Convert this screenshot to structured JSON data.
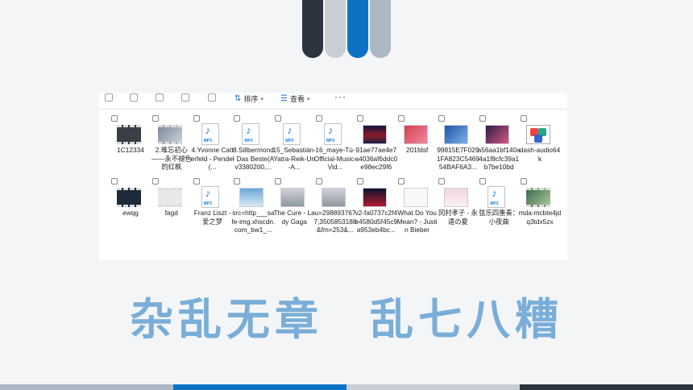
{
  "toolbar": {
    "sort_label": "排序",
    "view_label": "查看",
    "more_label": "···"
  },
  "files_row1": [
    {
      "name": "1C12334",
      "icon": "video-icon",
      "style": "ic-video"
    },
    {
      "name": "2.难忘初心——永不褪色的红枫",
      "icon": "video-icon",
      "style": "ic-video photo"
    },
    {
      "name": "4.Yvonne Catterfeld - Pendel(...",
      "icon": "mp3-icon",
      "style": "mp3"
    },
    {
      "name": "8.Sillbermond - Das Beste(Av3380200,...",
      "icon": "mp3-icon",
      "style": "mp3"
    },
    {
      "name": "15_Sebastián-Yatra-Reik-Un-A...",
      "icon": "mp3-icon",
      "style": "mp3"
    },
    {
      "name": "16_maye-Tú-Official-Music-Vid...",
      "icon": "mp3-icon",
      "style": "mp3"
    },
    {
      "name": "91ae77ae4e7a4036af6ddc0e98ec29f6",
      "icon": "image-icon",
      "style": "ic-img stage"
    },
    {
      "name": "201fdsf",
      "icon": "image-icon",
      "style": "ic-img red"
    },
    {
      "name": "99815E7F0291FA823C546954BAF6A3...",
      "icon": "image-icon",
      "style": "ic-img blue"
    },
    {
      "name": "a56aa1bf140a4a1f8cfc39a1b7be10bd",
      "icon": "image-icon",
      "style": "ic-img concert"
    },
    {
      "name": "dash-audio64k",
      "icon": "media-file-icon",
      "style": "dash"
    }
  ],
  "files_row2": [
    {
      "name": "ewqg",
      "icon": "video-icon",
      "style": "ic-video dark"
    },
    {
      "name": "fagd",
      "icon": "video-icon",
      "style": "ic-video frame"
    },
    {
      "name": "Franz Liszt - 爱之梦",
      "icon": "mp3-icon",
      "style": "mp3"
    },
    {
      "name": "src=http___safe-img.xhscdn.com_bw1_...",
      "icon": "image-icon",
      "style": "ic-img sky"
    },
    {
      "name": "The Cure - Lady Gaga",
      "icon": "image-icon",
      "style": "ic-img gray"
    },
    {
      "name": "u=2988937677,3505853188&fm=253&...",
      "icon": "image-icon",
      "style": "ic-img gray"
    },
    {
      "name": "v2-fa0737c2f4e4580d5f45c9a953eb4bc...",
      "icon": "image-icon",
      "style": "ic-img stage2"
    },
    {
      "name": "What Do You Mean? - Justin Bieber",
      "icon": "image-icon",
      "style": "ic-img paper"
    },
    {
      "name": "冈村孝子 - 永遠の夏",
      "icon": "image-icon",
      "style": "ic-img pink"
    },
    {
      "name": "弦乐四重奏：小夜曲",
      "icon": "mp3-icon",
      "style": "mp3"
    },
    {
      "name": "mda-mcbte4jdq3tdx5zx",
      "icon": "video-icon",
      "style": "ic-video green"
    }
  ],
  "headline": {
    "left": "杂乱无章",
    "right": "乱七八糟"
  }
}
